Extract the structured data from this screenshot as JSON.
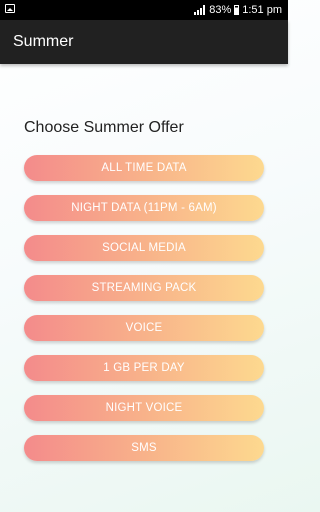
{
  "status_bar": {
    "battery": "83%",
    "time": "1:51 pm"
  },
  "app_bar": {
    "title": "Summer"
  },
  "main": {
    "heading": "Choose Summer Offer",
    "offers": [
      "ALL TIME DATA",
      "NIGHT DATA (11PM - 6AM)",
      "SOCIAL MEDIA",
      "STREAMING PACK",
      "VOICE",
      "1 GB PER DAY",
      "NIGHT VOICE",
      "SMS"
    ]
  },
  "colors": {
    "status_bar_bg": "#000000",
    "app_bar_bg": "#212121",
    "button_gradient_start": "#f48b8b",
    "button_gradient_end": "#fdd98f"
  }
}
